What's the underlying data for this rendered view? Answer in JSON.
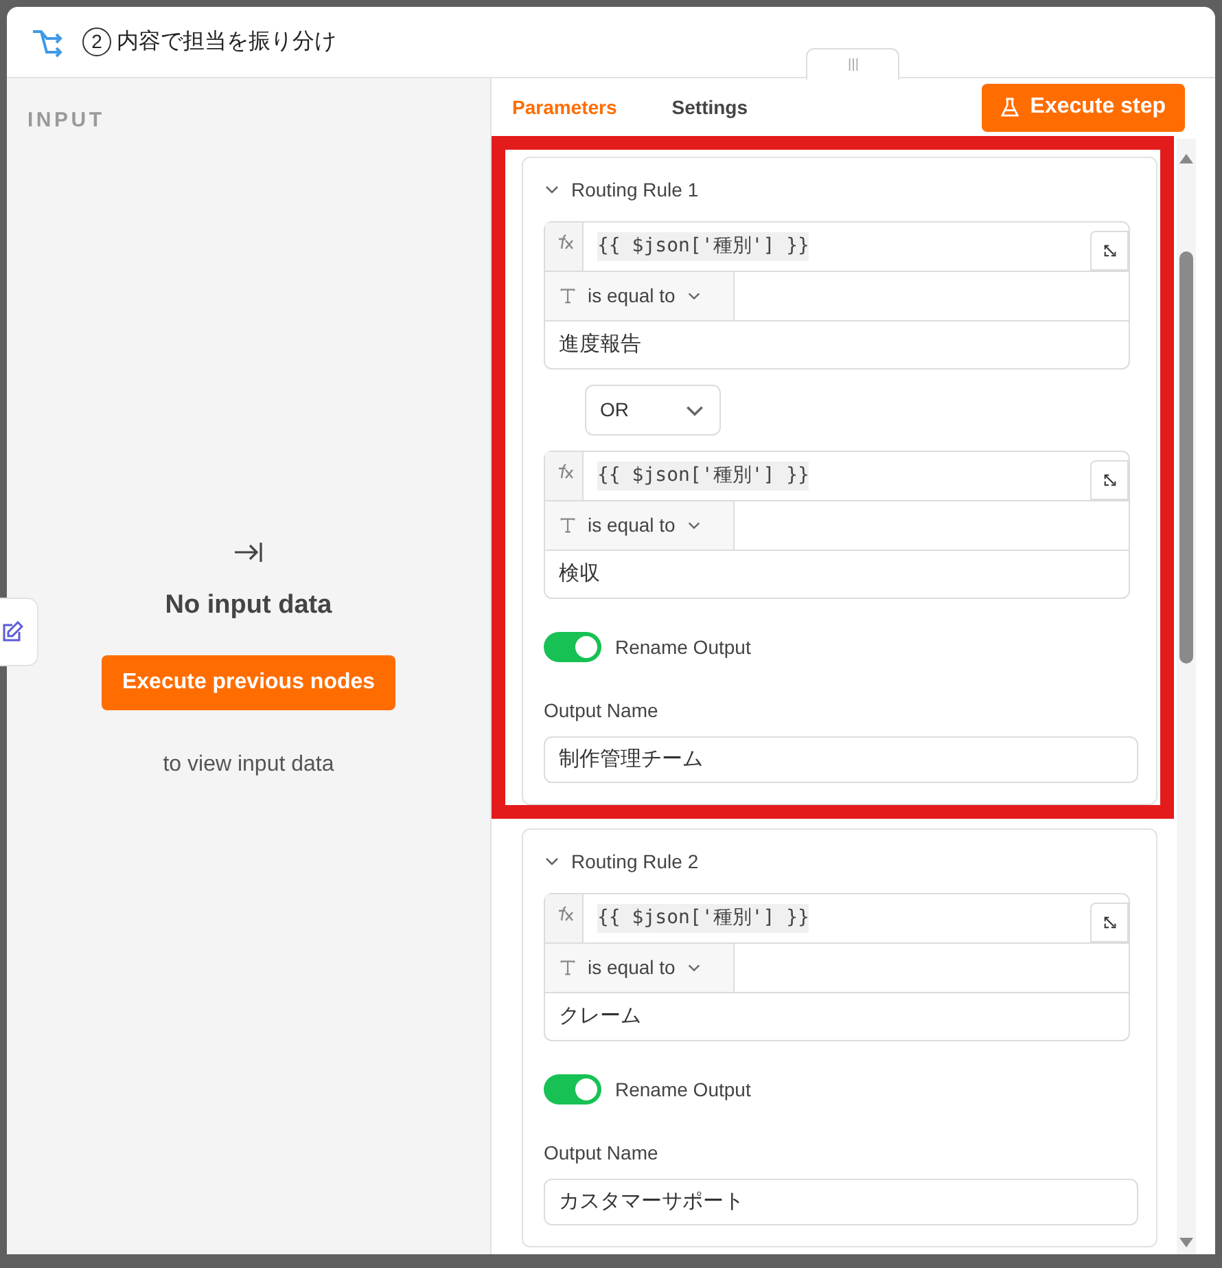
{
  "window": {
    "step_number": "2",
    "title": "内容で担当を振り分け"
  },
  "input_panel": {
    "heading": "INPUT",
    "message": "No input data",
    "button": "Execute previous nodes",
    "hint": "to view input data"
  },
  "tabs": [
    {
      "label": "Parameters",
      "selected": true
    },
    {
      "label": "Settings",
      "selected": false
    }
  ],
  "execute_button": "Execute step",
  "rules": [
    {
      "title": "Routing Rule 1",
      "expanded": true,
      "highlighted": true,
      "combinator": "OR",
      "conditions": [
        {
          "left": "{{ $json['種別'] }}",
          "operator": "is equal to",
          "right": "進度報告"
        },
        {
          "left": "{{ $json['種別'] }}",
          "operator": "is equal to",
          "right": "検収"
        }
      ],
      "rename_label": "Rename Output",
      "rename_output": true,
      "output_label": "Output Name",
      "output_name": "制作管理チーム"
    },
    {
      "title": "Routing Rule 2",
      "expanded": true,
      "highlighted": false,
      "conditions": [
        {
          "left": "{{ $json['種別'] }}",
          "operator": "is equal to",
          "right": "クレーム"
        }
      ],
      "rename_label": "Rename Output",
      "rename_output": true,
      "output_label": "Output Name",
      "output_name": "カスタマーサポート"
    }
  ]
}
